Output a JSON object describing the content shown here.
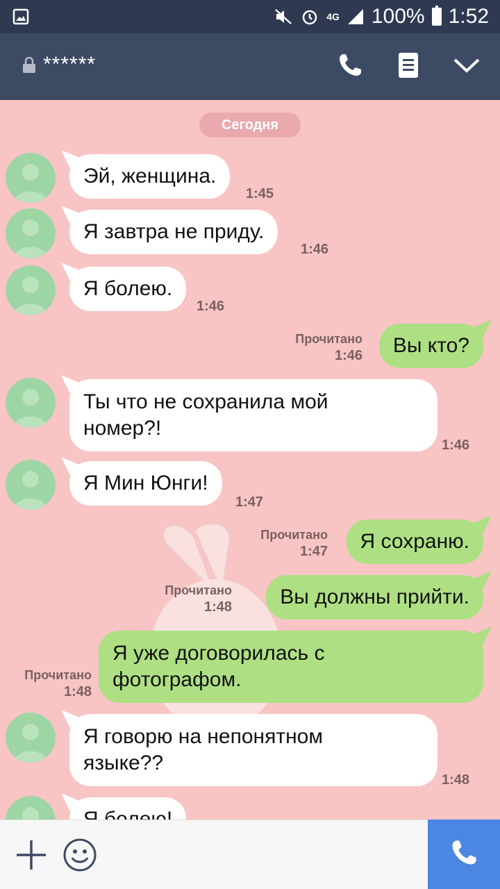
{
  "statusbar": {
    "network": "4G",
    "battery": "100%",
    "time": "1:52"
  },
  "header": {
    "title": "******",
    "icons": [
      "lock-icon",
      "phone-icon",
      "notes-icon",
      "chevron-down-icon"
    ]
  },
  "chat": {
    "date": "Сегодня",
    "messages": [
      {
        "dir": "in",
        "text": "Эй, женщина.",
        "time": "1:45"
      },
      {
        "dir": "in",
        "text": "Я завтра не приду.",
        "time": "1:46"
      },
      {
        "dir": "in",
        "text": "Я болею.",
        "time": "1:46"
      },
      {
        "dir": "out",
        "text": "Вы кто?",
        "read": "Прочитано",
        "time": "1:46"
      },
      {
        "dir": "in",
        "line1": "Ты что не сохранила мой",
        "line2": "номер?!",
        "time": "1:46"
      },
      {
        "dir": "in",
        "text": "Я Мин Юнги!",
        "time": "1:47"
      },
      {
        "dir": "out",
        "text": "Я сохраню.",
        "read": "Прочитано",
        "time": "1:47"
      },
      {
        "dir": "out",
        "text": "Вы должны прийти.",
        "read": "Прочитано",
        "time": "1:48"
      },
      {
        "dir": "out",
        "line1": "Я уже договорилась с",
        "line2": "фотографом.",
        "read": "Прочитано",
        "time": "1:48"
      },
      {
        "dir": "in",
        "line1": "Я говорю на непонятном",
        "line2": "языке??",
        "time": "1:48"
      },
      {
        "dir": "in",
        "text": "Я болею!"
      }
    ]
  },
  "input": {
    "icons": [
      "plus-icon",
      "emoji-icon",
      "call-icon"
    ]
  },
  "colors": {
    "chat_bg": "#f8c4c4",
    "header_bg": "#3d4a64",
    "incoming_bubble": "#ffffff",
    "outgoing_bubble": "#aee083",
    "call_button": "#4a86e2"
  }
}
